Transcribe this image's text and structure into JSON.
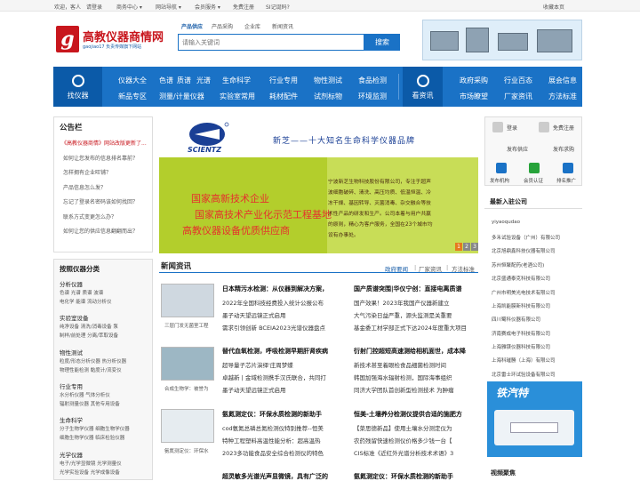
{
  "topbar": {
    "welcome": "欢迎，客人",
    "login": "请登录",
    "links": [
      "商务中心 ▾",
      "网站导航 ▾",
      "会员服务 ▾",
      "免费注册",
      "SI记诞码?"
    ],
    "favorite": "收藏本页"
  },
  "logo": {
    "name": "高教仪器商情网",
    "slogan": "gaojiao17 负责传媒旗下网站"
  },
  "search": {
    "tabs": [
      "产品供应",
      "产品采购",
      "企业库",
      "新闻资讯"
    ],
    "placeholder": "请输入关键词",
    "button": "搜索"
  },
  "nav": {
    "find_label": "找仪器",
    "read_label": "看资讯",
    "find_rows": [
      [
        "仪器大全",
        "色谱",
        "质谱",
        "光谱",
        "生命科学",
        "行业专用",
        "物性测试",
        "食品检测"
      ],
      [
        "新品专区",
        "测量/计量仪器",
        "实验室常用",
        "耗材配件",
        "试剂标物",
        "环境监测"
      ]
    ],
    "read_rows": [
      [
        "政府采购",
        "行业百态",
        "展会信息"
      ],
      [
        "市场瞭望",
        "厂家资讯",
        "方法标准"
      ]
    ]
  },
  "notice": {
    "title": "公告栏",
    "items": [
      "《高教仪器商情》网站改版更新了...",
      "如何让您发布的信息排名靠前？",
      "怎样拥有企业旺铺？",
      "产品信息怎么发？",
      "忘记了登录名密码该如何找回？",
      "联系方式变更怎么办？",
      "如何让您的供应信息翻翻而出？"
    ]
  },
  "categories": {
    "title": "按照仪器分类",
    "groups": [
      {
        "name": "分析仪器",
        "rows": [
          "色谱    光谱    质谱    波谱",
          "电化学   能谱    流动分析仪"
        ]
      },
      {
        "name": "实验室设备",
        "rows": [
          "纯净设备   清洗/消毒设备   泵",
          "制样/前处理   分离/萃取设备"
        ]
      },
      {
        "name": "物性测试",
        "rows": [
          "粒度/形态分析仪器   热分析仪器",
          "物理性能检测   黏度计/流变仪"
        ]
      },
      {
        "name": "行业专用",
        "rows": [
          "水分析仪器   气体分析仪",
          "辐射测量仪器   其他专用设备"
        ]
      },
      {
        "name": "生命科学",
        "rows": [
          "分子生物学仪器   细胞生物学仪器",
          "细胞生物学仪器   临床检验仪器"
        ]
      },
      {
        "name": "光学仪器",
        "rows": [
          "电子/光学显微镜   光学测量仪",
          "光学实验设备   光学成像设备"
        ]
      }
    ]
  },
  "banner": {
    "brand": "SCIENTZ",
    "tagline": "新芝——十大知名生命科学仪器品牌",
    "lines": [
      "国家高新技术企业",
      "国家高技术产业化示范工程基地",
      "高教仪器设备优质供应商"
    ],
    "desc": [
      "宁波新芝生物科技股份有限公司，专注于超声",
      "波细胞破碎、清洗、高压均质、低温恒温、冷",
      "冻干燥、基因转导、灭菌消毒、杂交融合等技",
      "术性产品的研发和生产。公司本着与用户共赢",
      "的原则，精心为客户服务，全国在23个城市均",
      "设有办事处。"
    ],
    "pages": [
      "1",
      "2",
      "3"
    ]
  },
  "news": {
    "title": "新闻资讯",
    "tabs": [
      "政府要闻",
      "厂家资讯",
      "方法标准"
    ],
    "separators": [
      "|",
      "|"
    ],
    "blocks": [
      {
        "caption": "三层门发无菌室工程",
        "mid_title": "日本精污水检测：从仪器到解决方案，",
        "mid": [
          "2022年全国科技经费投入统计公报公布",
          "墨子动天望远镜正式启用",
          "需求引领创新 BCEIA2023光谱仪器盘点"
        ],
        "right_title": "国产质谱突围|华仪宁创：直接电离质谱",
        "right": [
          "国产效果！2023年我国产仪器新建立",
          "大气污染日益严重，源头监测是关重要",
          "基金委工材学部正式下达2024年度重大项目"
        ]
      },
      {
        "caption": "合成生物学：被誉为",
        "mid_title": "替代血氧检测，呼吸检测早期肝肾疾病",
        "mid": [
          "超导量子芯片演绎'庄周梦蝶",
          "卓越新 | 金域检测携手汉氏联合，共同打",
          "墨子动天望远镜正式启用"
        ],
        "right_title": "衍射门控超短高速测给相机面世，成本降",
        "right": [
          "新技术甚至着眼检食品细菌检测时间",
          "韩国加强海水辐射检测，国际海事组织",
          "同济大学团队首创新型检测技术 为肿瘤"
        ]
      },
      {
        "caption": "氨氮测定仪：环保水",
        "mid_title": "氨氮测定仪：环保水质检测的新助手",
        "mid": [
          "cod氨氮总磷总氮检测仪特别推荐--恒美",
          "特种工程塑料高温性能分析：超高温热",
          "2023多功能食品安全综合检测仪的特色"
        ],
        "right_title": "恒美-土壤养分检测仪提供合适的施肥方",
        "right": [
          "【菜思德新品】使用土壤水分测定仪为",
          "农药残留快速检测仪价格多少钱一台【",
          "CIS标准《近红外光谱分析技术术语》3"
        ]
      }
    ],
    "cut_left": "超灵敏多光谱光声显微镜，具有广泛的",
    "cut_right": "氨氮测定仪：环保水质检测的新助手"
  },
  "right": {
    "buttons": [
      "登录",
      "免费注册",
      "发布供应",
      "发布求购",
      "发布机构",
      "会员认证",
      "排名推广"
    ],
    "join_title": "最新入驻公司",
    "companies": [
      "yiyaoqudao",
      "多禾试验设备（广州）有限公司",
      "北京旭鼎鑫科技仪器有限公司",
      "苏州恒聚配药(老酒公司)",
      "北京盛通泰克科技有限公司",
      "广州市明美光电技术有限公司",
      "上海凯能膜新科技有限公司",
      "四川蜀科仪器有限公司",
      "济南赛成电子科技有限公司",
      "上海雅镁仪器科技有限公司",
      "上海科璀勝（上海）有限公司",
      "北京雷士环试验设备有限公司"
    ],
    "ad_brand": "铁汽特",
    "video_title": "视频聚焦"
  },
  "colors": {
    "brand_red": "#c8161d",
    "nav_blue": "#1a72c6",
    "nav_dark": "#0b5aa8"
  }
}
